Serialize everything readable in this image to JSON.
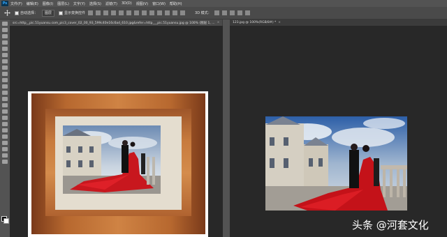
{
  "app": {
    "logo": "Ps"
  },
  "menu": [
    "文件(F)",
    "编辑(E)",
    "图像(I)",
    "图层(L)",
    "文字(Y)",
    "选择(S)",
    "滤镜(T)",
    "3D(D)",
    "视图(V)",
    "窗口(W)",
    "帮助(H)"
  ],
  "options": {
    "auto_select_label": "自动选择：",
    "auto_select_value": "图层",
    "show_transform_label": "显示变换控件",
    "mode_3d_label": "3D 模式："
  },
  "tabs": {
    "left": "src=http__pic.51yuansu.com_pic3_cover_02_00_93_599c40e16c6ad_610.jpg&refer=http___pic.51yuansu.jpg @ 100% (图层 1, ...",
    "right": "123.jpg @ 100%(RGB/8#) *"
  },
  "watermark": "头条 @河套文化",
  "colors": {
    "ui_panel": "#535353",
    "canvas_bg": "#282828",
    "tab_bg": "#3b3b3b"
  }
}
